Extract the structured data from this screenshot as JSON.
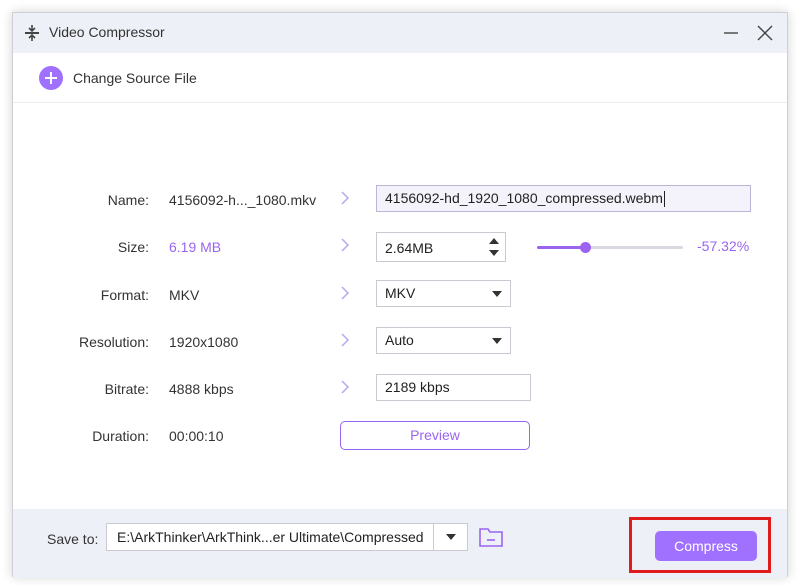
{
  "window": {
    "title": "Video Compressor",
    "title_icon": "compress-icon",
    "controls": [
      "minimize-icon",
      "close-icon"
    ]
  },
  "source": {
    "label": "Change Source File",
    "icon": "plus-circle-icon"
  },
  "rows": {
    "name": {
      "label": "Name:",
      "original": "4156092-h..._1080.mkv",
      "output": "4156092-hd_1920_1080_compressed.webm"
    },
    "size": {
      "label": "Size:",
      "original": "6.19 MB",
      "output": "2.64MB",
      "percent": "-57.32%",
      "slider_fraction": 0.33
    },
    "format": {
      "label": "Format:",
      "original": "MKV",
      "output": "MKV"
    },
    "resolution": {
      "label": "Resolution:",
      "original": "1920x1080",
      "output": "Auto"
    },
    "bitrate": {
      "label": "Bitrate:",
      "original": "4888 kbps",
      "output": "2189 kbps"
    },
    "duration": {
      "label": "Duration:",
      "original": "00:00:10"
    }
  },
  "preview_label": "Preview",
  "footer": {
    "save_label": "Save to:",
    "path": "E:\\ArkThinker\\ArkThink...er Ultimate\\Compressed",
    "folder_icon": "folder-icon",
    "compress_label": "Compress"
  },
  "colors": {
    "accent": "#a070ff",
    "highlight": "#e01b1b",
    "titlebar": "#eef0f8"
  }
}
